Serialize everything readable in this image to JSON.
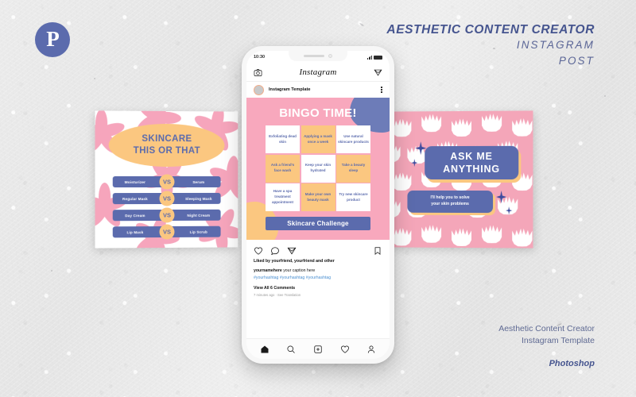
{
  "header": {
    "logo_letter": "P",
    "title_line1": "AESTHETIC CONTENT CREATOR",
    "title_line2": "INSTAGRAM",
    "title_line3": "POST"
  },
  "footer": {
    "line1": "Aesthetic Content Creator",
    "line2": "Instagram Template",
    "software": "Photoshop"
  },
  "left_card": {
    "title_line1": "SKINCARE",
    "title_line2": "THIS OR THAT",
    "vs_label": "VS",
    "rows": [
      {
        "left": "Moisturizer",
        "right": "Serum"
      },
      {
        "left": "Regular Mask",
        "right": "Sleeping Mask"
      },
      {
        "left": "Day Cream",
        "right": "Night Cream"
      },
      {
        "left": "Lip Mask",
        "right": "Lip Scrub"
      }
    ]
  },
  "right_card": {
    "title_line1": "ASK ME",
    "title_line2": "ANYTHING",
    "sub_line1": "I'll help you to solve",
    "sub_line2": "your skin problems"
  },
  "phone": {
    "status": {
      "time": "10:30"
    },
    "app": {
      "wordmark": "Instagram"
    },
    "post_header": {
      "username": "Instagram Template"
    },
    "post": {
      "title": "BINGO TIME!",
      "cells": [
        "Exfoliating dead skin",
        "Applying a mask once a week",
        "Use natural skincare products",
        "Ask a friend's face wash",
        "Keep your skin hydrated",
        "Take a beauty sleep",
        "Have a spa treatment appointment",
        "Make your own beauty mask",
        "Try new skincare product"
      ],
      "cta": "Skincare Challenge"
    },
    "caption": {
      "likes": "Liked by yourfriend, yourfriend and other",
      "username": "yournamehere",
      "text": " your caption here",
      "hashtags": "#yourhashtag #yourhashtag #yourhashtag",
      "view_all": "View All 6 Comments",
      "time": "7 minutes ago · See Translation"
    },
    "nav": [
      "home-icon",
      "search-icon",
      "add-post-icon",
      "activity-icon",
      "profile-icon"
    ]
  },
  "colors": {
    "indigo": "#5b6bad",
    "pink": "#f8a8bd",
    "orange": "#fbc780",
    "flower_pink": "#f6a5bc",
    "title_blue": "#46558f"
  }
}
